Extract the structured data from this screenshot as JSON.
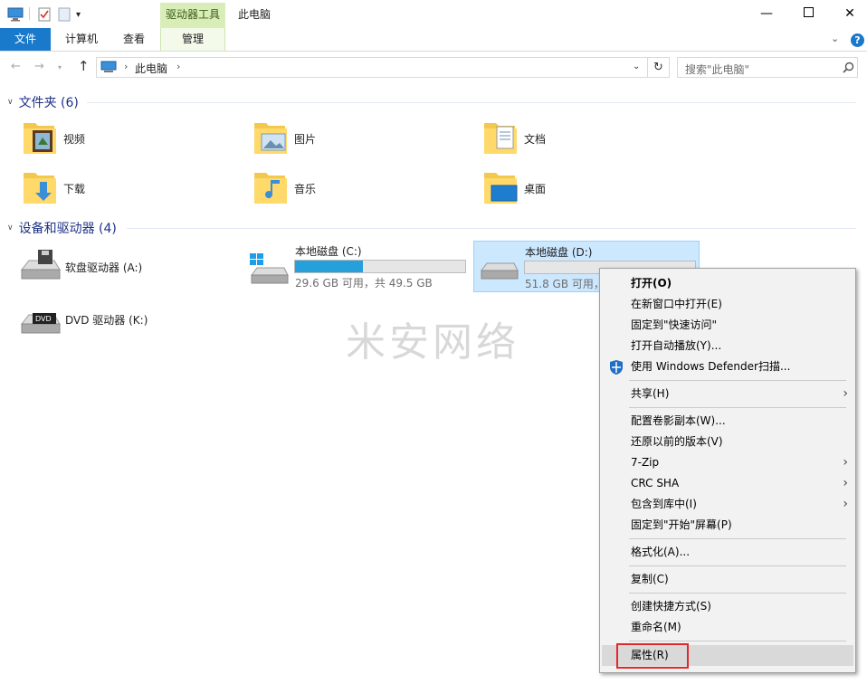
{
  "titlebar": {
    "context_tab_header": "驱动器工具",
    "window_title": "此电脑",
    "minimize_icon": "minimize-icon",
    "maximize_icon": "maximize-icon",
    "close_icon": "close-icon"
  },
  "ribbon": {
    "tabs": [
      {
        "label": "文件"
      },
      {
        "label": "计算机"
      },
      {
        "label": "查看"
      },
      {
        "label": "管理"
      }
    ],
    "help_label": "?",
    "accent": "#1979ca"
  },
  "address": {
    "path": "此电脑",
    "search_placeholder": "搜索\"此电脑\""
  },
  "folders_group": {
    "title": "文件夹 (6)",
    "items": [
      {
        "label": "视频",
        "icon": "video-folder-icon"
      },
      {
        "label": "图片",
        "icon": "pictures-folder-icon"
      },
      {
        "label": "文档",
        "icon": "documents-folder-icon"
      },
      {
        "label": "下载",
        "icon": "downloads-folder-icon"
      },
      {
        "label": "音乐",
        "icon": "music-folder-icon"
      },
      {
        "label": "桌面",
        "icon": "desktop-folder-icon"
      }
    ]
  },
  "drives_group": {
    "title": "设备和驱动器 (4)",
    "items": [
      {
        "name": "软盘驱动器 (A:)",
        "icon": "floppy-drive-icon"
      },
      {
        "name": "本地磁盘 (C:)",
        "free": "29.6 GB 可用，共 49.5 GB",
        "used_fraction": 0.4,
        "icon": "windows-disk-icon"
      },
      {
        "name": "本地磁盘 (D:)",
        "free": "51.8 GB 可用，",
        "used_fraction": 0.0,
        "icon": "disk-icon"
      },
      {
        "name": "DVD 驱动器 (K:)",
        "icon": "dvd-drive-icon"
      }
    ]
  },
  "watermark": "米安网络",
  "context_menu": {
    "items": [
      {
        "label": "打开(O)"
      },
      {
        "label": "在新窗口中打开(E)"
      },
      {
        "label": "固定到\"快速访问\""
      },
      {
        "label": "打开自动播放(Y)..."
      },
      {
        "label": "使用 Windows Defender扫描..."
      },
      {
        "label": "共享(H)"
      },
      {
        "label": "配置卷影副本(W)..."
      },
      {
        "label": "还原以前的版本(V)"
      },
      {
        "label": "7-Zip"
      },
      {
        "label": "CRC SHA"
      },
      {
        "label": "包含到库中(I)"
      },
      {
        "label": "固定到\"开始\"屏幕(P)"
      },
      {
        "label": "格式化(A)..."
      },
      {
        "label": "复制(C)"
      },
      {
        "label": "创建快捷方式(S)"
      },
      {
        "label": "重命名(M)"
      },
      {
        "label": "属性(R)"
      }
    ],
    "highlight_color": "#e0292b"
  }
}
